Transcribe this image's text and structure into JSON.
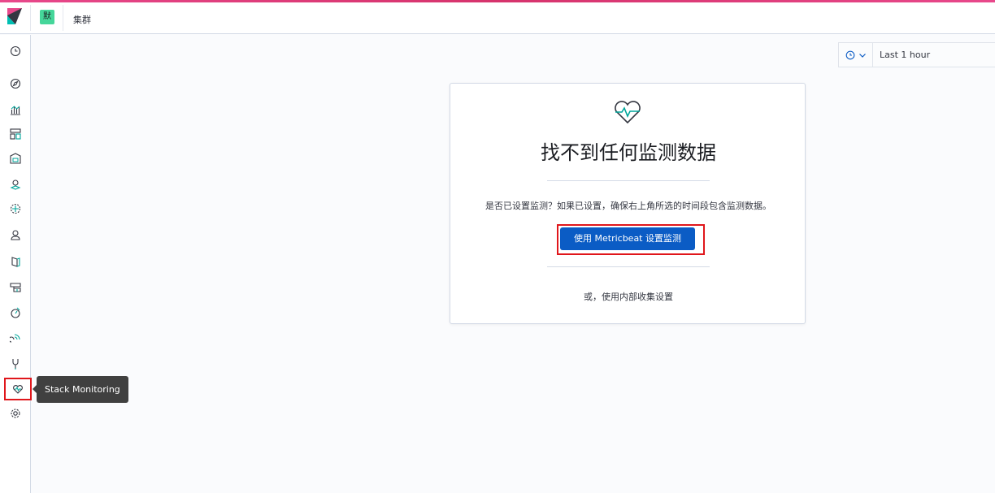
{
  "header": {
    "space_badge": "默",
    "breadcrumb": "集群",
    "accent_color": "#e8488b"
  },
  "sidebar": {
    "items": [
      {
        "icon": "clock-icon",
        "label": "Recently viewed"
      },
      {
        "icon": "compass-icon",
        "label": "Discover"
      },
      {
        "icon": "visualize-icon",
        "label": "Visualize"
      },
      {
        "icon": "dashboard-icon",
        "label": "Dashboard"
      },
      {
        "icon": "canvas-icon",
        "label": "Canvas"
      },
      {
        "icon": "maps-icon",
        "label": "Maps"
      },
      {
        "icon": "ml-icon",
        "label": "Machine Learning"
      },
      {
        "icon": "infrastructure-icon",
        "label": "Infrastructure"
      },
      {
        "icon": "logs-icon",
        "label": "Logs"
      },
      {
        "icon": "apm-icon",
        "label": "APM"
      },
      {
        "icon": "uptime-icon",
        "label": "Uptime"
      },
      {
        "icon": "siem-icon",
        "label": "SIEM"
      },
      {
        "icon": "devtools-icon",
        "label": "Dev Tools"
      },
      {
        "icon": "monitoring-icon",
        "label": "Stack Monitoring",
        "active": true
      },
      {
        "icon": "management-icon",
        "label": "Management"
      }
    ]
  },
  "tooltip": {
    "text": "Stack Monitoring"
  },
  "timepicker": {
    "value": "Last 1 hour"
  },
  "panel": {
    "title": "找不到任何监测数据",
    "description": "是否已设置监测？如果已设置，确保右上角所选的时间段包含监测数据。",
    "primary_button": "使用 Metricbeat 设置监测",
    "secondary_link": "或，使用内部收集设置",
    "primary_color": "#0b5cc5",
    "highlight_color": "#e0161b"
  }
}
